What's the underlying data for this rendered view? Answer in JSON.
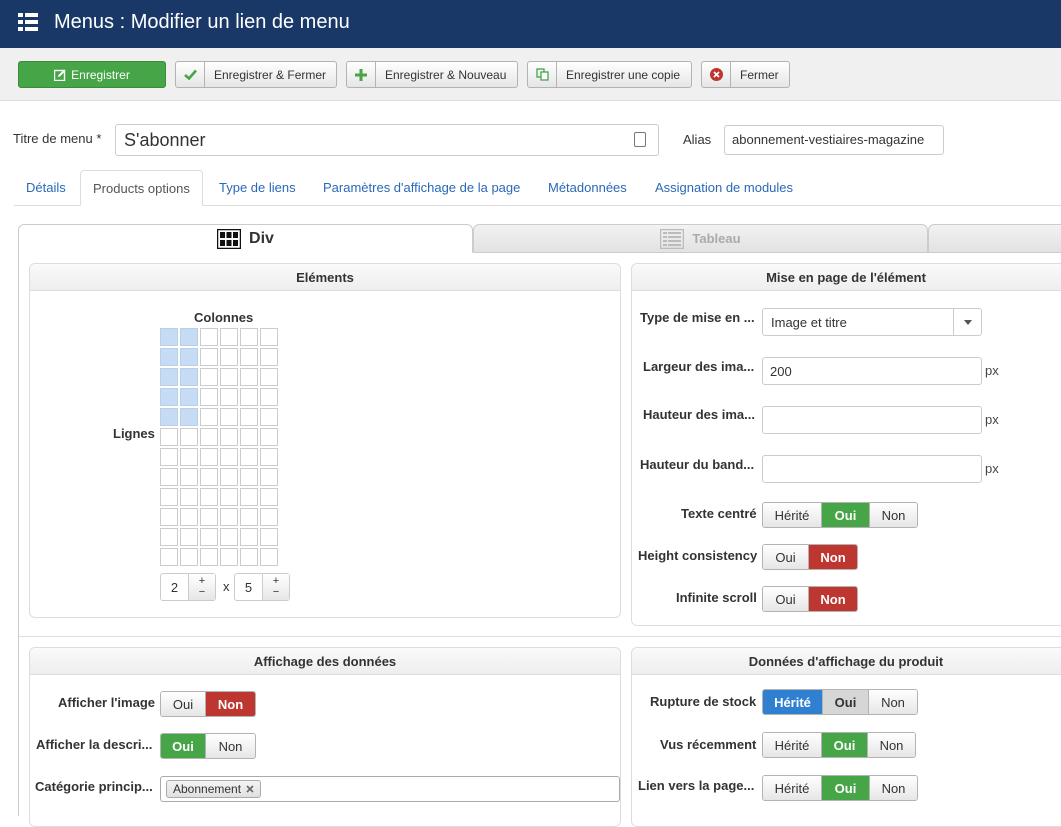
{
  "header": {
    "title": "Menus : Modifier un lien de menu",
    "icon": "list-icon"
  },
  "toolbar": {
    "save": "Enregistrer",
    "save_close": "Enregistrer & Fermer",
    "save_new": "Enregistrer & Nouveau",
    "save_copy": "Enregistrer une copie",
    "close": "Fermer"
  },
  "form": {
    "title_label": "Titre de menu *",
    "title_value": "S'abonner",
    "alias_label": "Alias",
    "alias_value": "abonnement-vestiaires-magazine"
  },
  "tabs": [
    "Détails",
    "Products options",
    "Type de liens",
    "Paramètres d'affichage de la page",
    "Métadonnées",
    "Assignation de modules"
  ],
  "inner_tabs": {
    "div": "Div",
    "table": "Tableau"
  },
  "elements": {
    "header": "Eléments",
    "columns_label": "Colonnes",
    "rows_label": "Lignes",
    "rows_value": "2",
    "times": "x",
    "cols_value": "5",
    "grid_cols": 6,
    "grid_rows": 12,
    "selected_cols": 2,
    "selected_rows": 5
  },
  "layout": {
    "header": "Mise en page de l'élément",
    "type_label": "Type de mise en ...",
    "type_value": "Image et titre",
    "width_label": "Largeur des ima...",
    "width_value": "200",
    "height_label": "Hauteur des ima...",
    "band_label": "Hauteur du band...",
    "unit": "px",
    "center_label": "Texte centré",
    "consistency_label": "Height consistency",
    "infinite_label": "Infinite scroll"
  },
  "display": {
    "header": "Affichage des données",
    "image_label": "Afficher l'image",
    "desc_label": "Afficher la descri...",
    "category_label": "Catégorie princip...",
    "category_chip": "Abonnement"
  },
  "product": {
    "header": "Données d'affichage du produit",
    "stock_label": "Rupture de stock",
    "recent_label": "Vus récemment",
    "link_label": "Lien vers la page..."
  },
  "options": {
    "inherit": "Hérité",
    "yes": "Oui",
    "no": "Non"
  },
  "colors": {
    "header_bg": "#1a3867",
    "green": "#46a546",
    "red": "#bd362f",
    "blue": "#2f80d1",
    "link": "#2a69b8"
  }
}
